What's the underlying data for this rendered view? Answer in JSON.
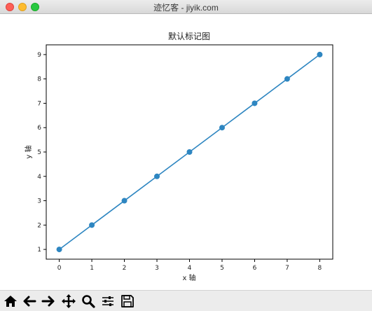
{
  "window": {
    "title": "迹忆客 - jiyik.com"
  },
  "toolbar": {
    "buttons": [
      {
        "name": "home-icon"
      },
      {
        "name": "back-arrow-icon"
      },
      {
        "name": "forward-arrow-icon"
      },
      {
        "name": "pan-icon"
      },
      {
        "name": "zoom-icon"
      },
      {
        "name": "configure-subplots-icon"
      },
      {
        "name": "save-icon"
      }
    ]
  },
  "chart_data": {
    "type": "line",
    "title": "默认标记图",
    "xlabel": "x 轴",
    "ylabel": "y 轴",
    "x": [
      0,
      1,
      2,
      3,
      4,
      5,
      6,
      7,
      8
    ],
    "series": [
      {
        "values": [
          1,
          2,
          3,
          4,
          5,
          6,
          7,
          8,
          9
        ],
        "color": "#2e86c1",
        "marker": "o"
      }
    ],
    "xticks": [
      "0",
      "1",
      "2",
      "3",
      "4",
      "5",
      "6",
      "7",
      "8"
    ],
    "yticks": [
      "1",
      "2",
      "3",
      "4",
      "5",
      "6",
      "7",
      "8",
      "9"
    ],
    "xlim": [
      -0.4,
      8.4
    ],
    "ylim": [
      0.6,
      9.4
    ],
    "grid": false
  }
}
